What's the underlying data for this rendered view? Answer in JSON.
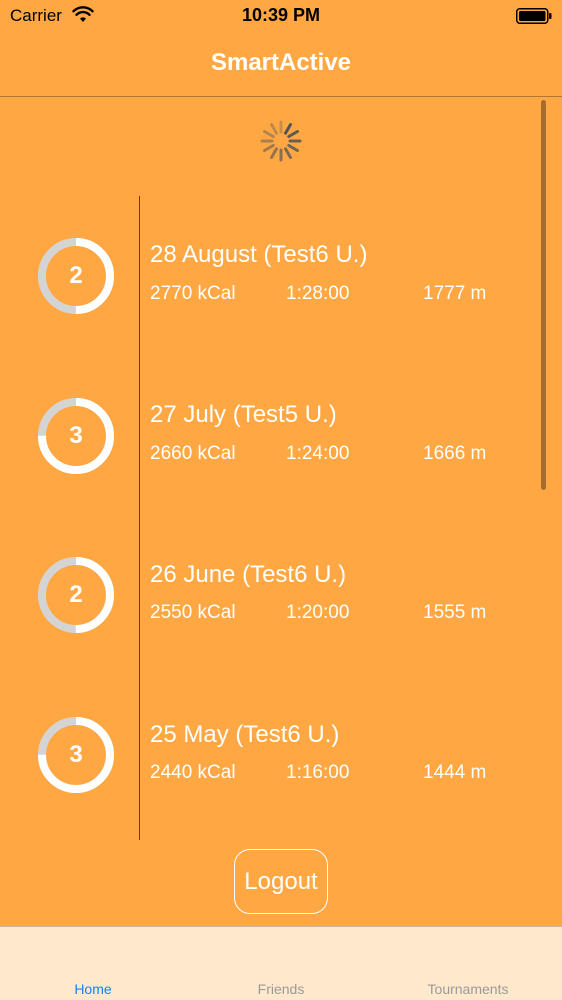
{
  "status_bar": {
    "carrier": "Carrier",
    "time": "10:39 PM"
  },
  "nav": {
    "title": "SmartActive"
  },
  "activities": [
    {
      "count": "2",
      "progress": 0.5,
      "title": "28 August (Test6 U.)",
      "kcal": "2770 kCal",
      "duration": "1:28:00",
      "distance": "1777 m"
    },
    {
      "count": "3",
      "progress": 0.75,
      "title": "27 July (Test5 U.)",
      "kcal": "2660 kCal",
      "duration": "1:24:00",
      "distance": "1666 m"
    },
    {
      "count": "2",
      "progress": 0.5,
      "title": "26 June (Test6 U.)",
      "kcal": "2550 kCal",
      "duration": "1:20:00",
      "distance": "1555 m"
    },
    {
      "count": "3",
      "progress": 0.75,
      "title": "25 May (Test6 U.)",
      "kcal": "2440 kCal",
      "duration": "1:16:00",
      "distance": "1444 m"
    }
  ],
  "logout_label": "Logout",
  "tabs": [
    {
      "label": "Home",
      "active": true
    },
    {
      "label": "Friends",
      "active": false
    },
    {
      "label": "Tournaments",
      "active": false
    }
  ],
  "colors": {
    "background": "#ffa843",
    "ring_track": "#d4d4d4",
    "ring_fill": "#ffffff",
    "tab_active": "#1a7ef5",
    "tab_inactive": "#9a9a9a"
  },
  "icons": {
    "wifi": "wifi-icon",
    "battery": "battery-icon",
    "spinner": "loading-spinner-icon"
  }
}
